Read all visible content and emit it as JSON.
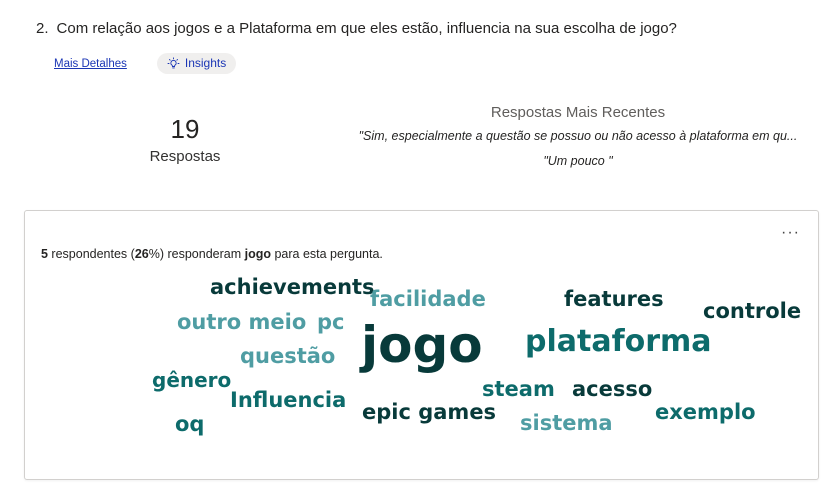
{
  "question": {
    "number": "2.",
    "text": "Com relação aos jogos e a Plataforma em que eles estão, influencia na sua escolha de jogo?"
  },
  "links": {
    "more_details": "Mais Detalhes",
    "insights": "Insights"
  },
  "responses": {
    "count": "19",
    "label": "Respostas"
  },
  "recent": {
    "title": "Respostas Mais Recentes",
    "quotes": [
      "\"Sim, especialmente a questão se possuo ou não acesso à plataforma em qu...",
      "\"Um pouco \""
    ]
  },
  "card": {
    "menu_icon": "more-horizontal-icon",
    "summary": {
      "count": "5",
      "text1": " respondentes (",
      "percent": "26",
      "text2": "%) responderam ",
      "keyword": "jogo",
      "text3": " para esta pergunta."
    }
  },
  "colors": {
    "dark": "#083a3a",
    "teal": "#0d6b6b",
    "light": "#4f9da3",
    "link": "#1b36b5"
  },
  "word_cloud": [
    {
      "text": "achievements",
      "color": "dark"
    },
    {
      "text": "facilidade",
      "color": "light"
    },
    {
      "text": "features",
      "color": "dark"
    },
    {
      "text": "controle",
      "color": "dark"
    },
    {
      "text": "outro meio",
      "color": "light"
    },
    {
      "text": "pc",
      "color": "light"
    },
    {
      "text": "jogo",
      "color": "dark"
    },
    {
      "text": "plataforma",
      "color": "teal"
    },
    {
      "text": "questão",
      "color": "light"
    },
    {
      "text": "gênero",
      "color": "teal"
    },
    {
      "text": "steam",
      "color": "teal"
    },
    {
      "text": "acesso",
      "color": "dark"
    },
    {
      "text": "Influencia",
      "color": "teal"
    },
    {
      "text": "epic games",
      "color": "dark"
    },
    {
      "text": "exemplo",
      "color": "teal"
    },
    {
      "text": "oq",
      "color": "teal"
    },
    {
      "text": "sistema",
      "color": "light"
    }
  ]
}
